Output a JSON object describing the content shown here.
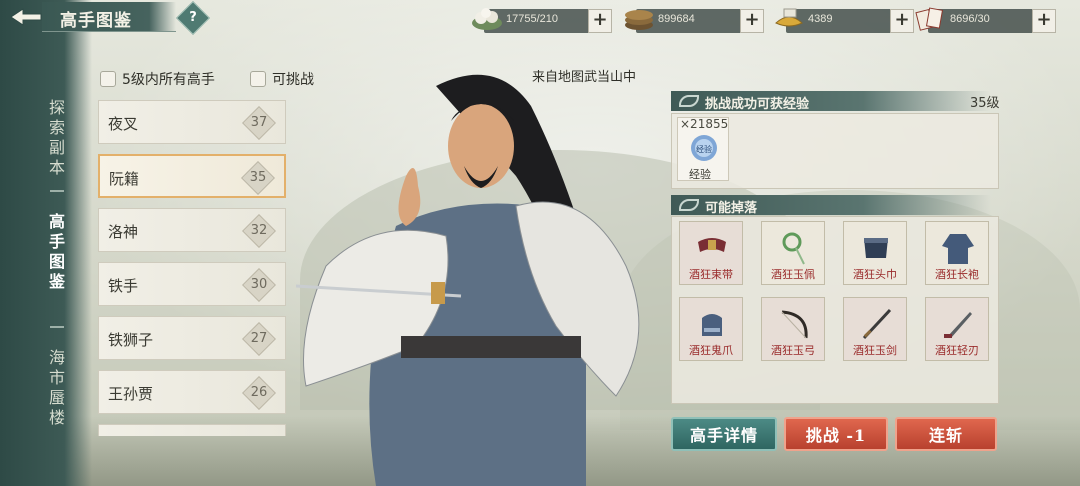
{
  "header": {
    "title": "高手图鉴",
    "help_label": "?"
  },
  "resources": [
    {
      "icon": "rice-cake-icon",
      "value": "17755/210"
    },
    {
      "icon": "copper-coins-icon",
      "value": "899684"
    },
    {
      "icon": "gold-ingot-icon",
      "value": "4389"
    },
    {
      "icon": "ticket-cards-icon",
      "value": "8696/30"
    }
  ],
  "sidebar": {
    "items": [
      {
        "label": "探索副本"
      },
      {
        "label": "高手图鉴",
        "active": true
      },
      {
        "label": "海市蜃楼"
      }
    ]
  },
  "filters": {
    "all_within_5": "5级内所有高手",
    "challengeable": "可挑战"
  },
  "bosses": [
    {
      "name": "夜叉",
      "level": "37"
    },
    {
      "name": "阮籍",
      "level": "35",
      "selected": true
    },
    {
      "name": "洛神",
      "level": "32"
    },
    {
      "name": "铁手",
      "level": "30"
    },
    {
      "name": "铁狮子",
      "level": "27"
    },
    {
      "name": "王孙贾",
      "level": "26"
    }
  ],
  "location": "来自地图武当山中",
  "exp_section": {
    "title": "挑战成功可获经验",
    "level": "35级",
    "reward_count": "×21855",
    "reward_icon_text": "经验",
    "reward_label": "经验"
  },
  "drops_section": {
    "title": "可能掉落",
    "items": [
      {
        "name": "酒狂束带",
        "icon": "belt-icon"
      },
      {
        "name": "酒狂玉佩",
        "icon": "jade-pendant-icon"
      },
      {
        "name": "酒狂头巾",
        "icon": "headscarf-icon"
      },
      {
        "name": "酒狂长袍",
        "icon": "robe-icon"
      },
      {
        "name": "酒狂鬼爪",
        "icon": "gauntlet-icon"
      },
      {
        "name": "酒狂玉弓",
        "icon": "bow-icon"
      },
      {
        "name": "酒狂玉剑",
        "icon": "sword-icon"
      },
      {
        "name": "酒狂轻刃",
        "icon": "blade-icon"
      }
    ]
  },
  "actions": {
    "details": "高手详情",
    "challenge": "挑战 -1",
    "sweep": "连斩"
  },
  "colors": {
    "accent_teal": "#3f6e69",
    "accent_red": "#c9503a",
    "selected_border": "#e3b06a",
    "drop_text": "#9a2b2b"
  }
}
